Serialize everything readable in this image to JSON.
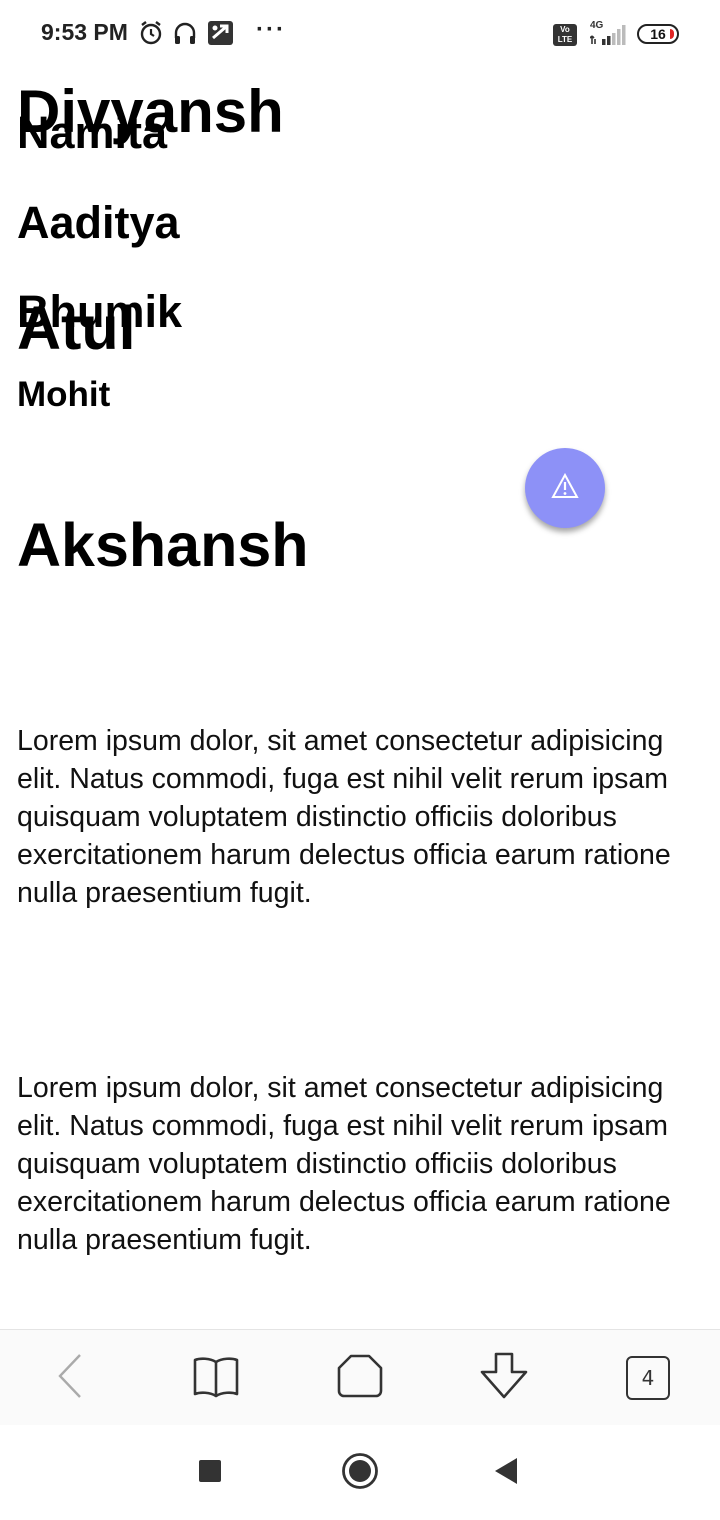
{
  "status_bar": {
    "time": "9:53 PM",
    "icons": [
      "alarm-icon",
      "headphones-icon",
      "app-notification-icon",
      "more-notifications-icon"
    ],
    "volte_label": "Vo LTE",
    "network_label": "4G",
    "battery_level": "16"
  },
  "headings": [
    {
      "text": "Divyansh",
      "level": "h1"
    },
    {
      "text": "Namita",
      "level": "h2"
    },
    {
      "text": "Atul",
      "level": "h1"
    },
    {
      "text": "Aaditya",
      "level": "h2"
    },
    {
      "text": "Akshansh",
      "level": "h1"
    },
    {
      "text": "Bhumik",
      "level": "h2"
    }
  ],
  "paragraph_1": "Lorem ipsum dolor, sit amet consectetur adipisicing elit. Natus commodi, fuga est nihil velit rerum ipsam quisquam voluptatem distinctio officiis doloribus exercitationem harum delectus officia earum ratione nulla praesentium fugit.",
  "subheading": "Mohit",
  "paragraph_2": "Lorem ipsum dolor, sit amet consectetur adipisicing elit. Natus commodi, fuga est nihil velit rerum ipsam quisquam voluptatem distinctio officiis doloribus exercitationem harum delectus officia earum ratione nulla praesentium fugit.",
  "fab": {
    "icon": "warning-icon",
    "color": "#8d91f7"
  },
  "toolbar": {
    "buttons": [
      "back-icon",
      "bookmarks-icon",
      "home-icon",
      "download-icon",
      "tabs-icon"
    ],
    "tab_count": "4"
  },
  "navbar": {
    "buttons": [
      "recents-icon",
      "home-icon",
      "back-icon"
    ]
  }
}
